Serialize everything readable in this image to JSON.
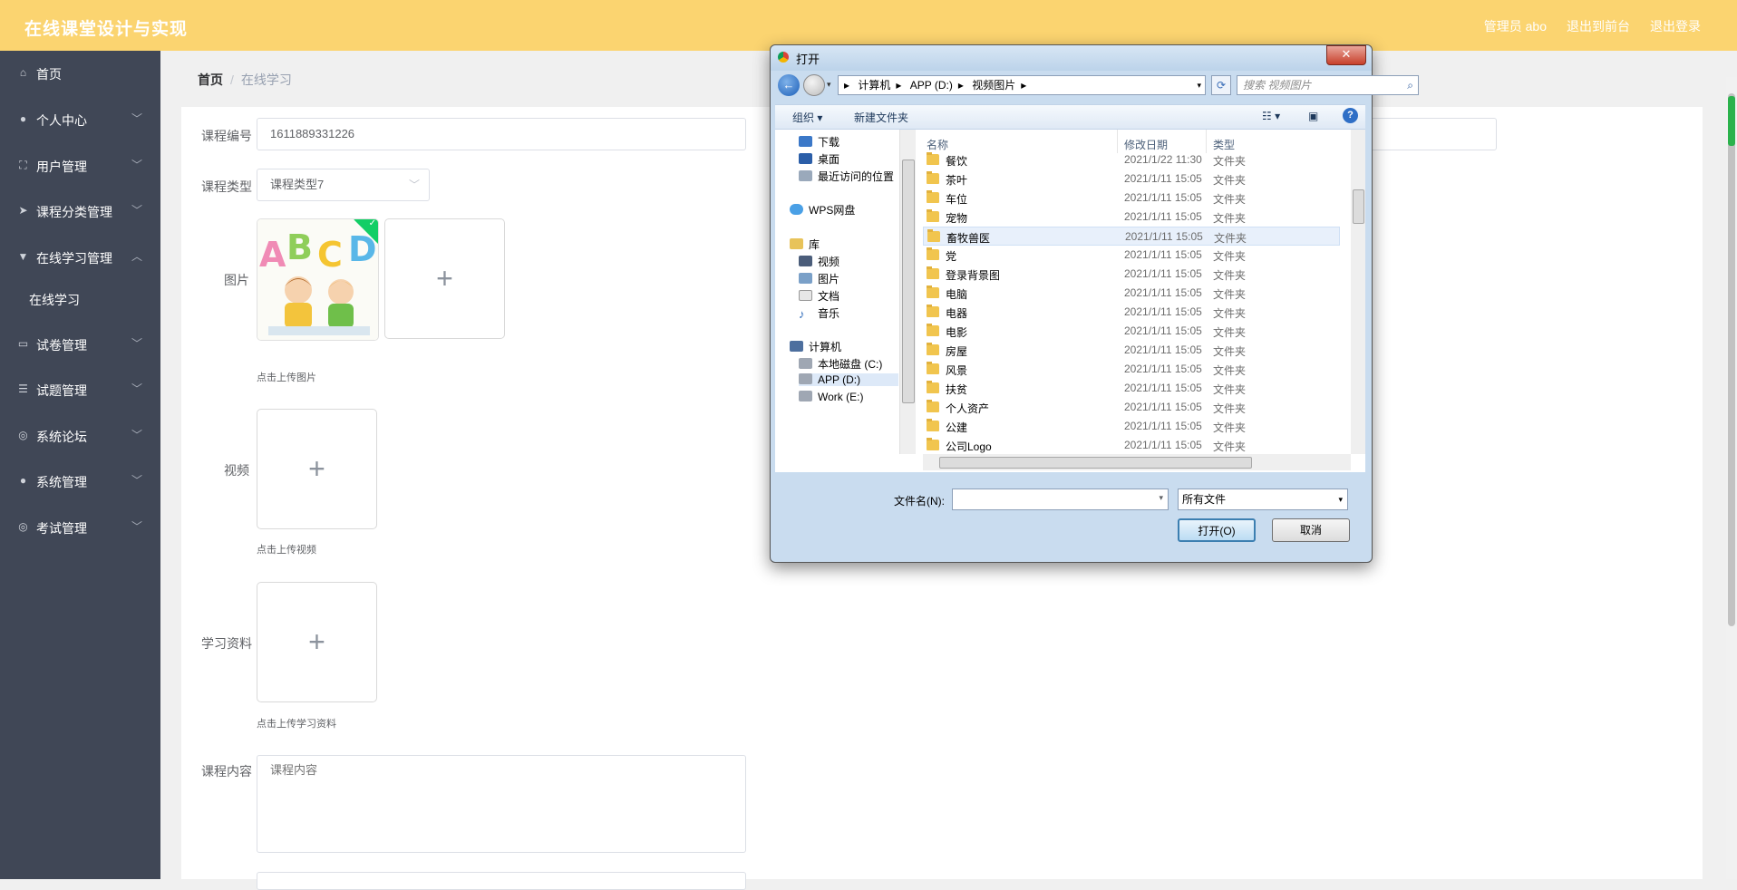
{
  "app": {
    "title": "在线课堂设计与实现",
    "top_links": [
      "管理员 abo",
      "退出到前台",
      "退出登录"
    ]
  },
  "sidebar": {
    "items": [
      {
        "label": "首页",
        "icon": "home-icon",
        "arrow": ""
      },
      {
        "label": "个人中心",
        "icon": "user-icon",
        "arrow": "﹀"
      },
      {
        "label": "用户管理",
        "icon": "frame-icon",
        "arrow": "﹀"
      },
      {
        "label": "课程分类管理",
        "icon": "send-icon",
        "arrow": "﹀"
      },
      {
        "label": "在线学习管理",
        "icon": "bookmark-icon",
        "arrow": "︿"
      },
      {
        "label": "试卷管理",
        "icon": "chat-icon",
        "arrow": "﹀"
      },
      {
        "label": "试题管理",
        "icon": "list-icon",
        "arrow": "﹀"
      },
      {
        "label": "系统论坛",
        "icon": "compass-icon",
        "arrow": "﹀"
      },
      {
        "label": "系统管理",
        "icon": "user-icon",
        "arrow": "﹀"
      },
      {
        "label": "考试管理",
        "icon": "compass-icon",
        "arrow": "﹀"
      }
    ],
    "sub_item": "在线学习"
  },
  "breadcrumb": {
    "home": "首页",
    "sep": "/",
    "current": "在线学习"
  },
  "form": {
    "course_no_label": "课程编号",
    "course_no_value": "1611889331226",
    "course_type_label": "课程类型",
    "course_type_value": "课程类型7",
    "image_label": "图片",
    "image_hint": "点击上传图片",
    "video_label": "视频",
    "video_hint": "点击上传视频",
    "material_label": "学习资料",
    "material_hint": "点击上传学习资料",
    "content_label": "课程内容",
    "content_placeholder": "课程内容",
    "thumb_letters": "ABCD"
  },
  "dialog": {
    "title": "打开",
    "close": "✕",
    "address": [
      "计算机",
      "APP (D:)",
      "视频图片"
    ],
    "search_placeholder": "搜索 视频图片",
    "toolbar_organize": "组织 ▾",
    "toolbar_new_folder": "新建文件夹",
    "help": "?",
    "nav_items": [
      "下载",
      "桌面",
      "最近访问的位置",
      "WPS网盘",
      "库",
      "视频",
      "图片",
      "文档",
      "音乐",
      "计算机",
      "本地磁盘 (C:)",
      "APP (D:)",
      "Work (E:)"
    ],
    "col_name": "名称",
    "col_date": "修改日期",
    "col_type": "类型",
    "files": [
      {
        "name": "餐饮",
        "date": "2021/1/22 11:30",
        "type": "文件夹"
      },
      {
        "name": "茶叶",
        "date": "2021/1/11 15:05",
        "type": "文件夹"
      },
      {
        "name": "车位",
        "date": "2021/1/11 15:05",
        "type": "文件夹"
      },
      {
        "name": "宠物",
        "date": "2021/1/11 15:05",
        "type": "文件夹"
      },
      {
        "name": "畜牧兽医",
        "date": "2021/1/11 15:05",
        "type": "文件夹"
      },
      {
        "name": "党",
        "date": "2021/1/11 15:05",
        "type": "文件夹"
      },
      {
        "name": "登录背景图",
        "date": "2021/1/11 15:05",
        "type": "文件夹"
      },
      {
        "name": "电脑",
        "date": "2021/1/11 15:05",
        "type": "文件夹"
      },
      {
        "name": "电器",
        "date": "2021/1/11 15:05",
        "type": "文件夹"
      },
      {
        "name": "电影",
        "date": "2021/1/11 15:05",
        "type": "文件夹"
      },
      {
        "name": "房屋",
        "date": "2021/1/11 15:05",
        "type": "文件夹"
      },
      {
        "name": "风景",
        "date": "2021/1/11 15:05",
        "type": "文件夹"
      },
      {
        "name": "扶贫",
        "date": "2021/1/11 15:05",
        "type": "文件夹"
      },
      {
        "name": "个人资产",
        "date": "2021/1/11 15:05",
        "type": "文件夹"
      },
      {
        "name": "公建",
        "date": "2021/1/11 15:05",
        "type": "文件夹"
      },
      {
        "name": "公司Logo",
        "date": "2021/1/11 15:05",
        "type": "文件夹"
      }
    ],
    "filename_label": "文件名(N):",
    "filename_value": "",
    "filter_value": "所有文件",
    "open_button": "打开(O)",
    "cancel_button": "取消"
  },
  "colors": {
    "topbar": "#fbd470",
    "sidebar": "#404756",
    "accent": "#13ce66"
  }
}
